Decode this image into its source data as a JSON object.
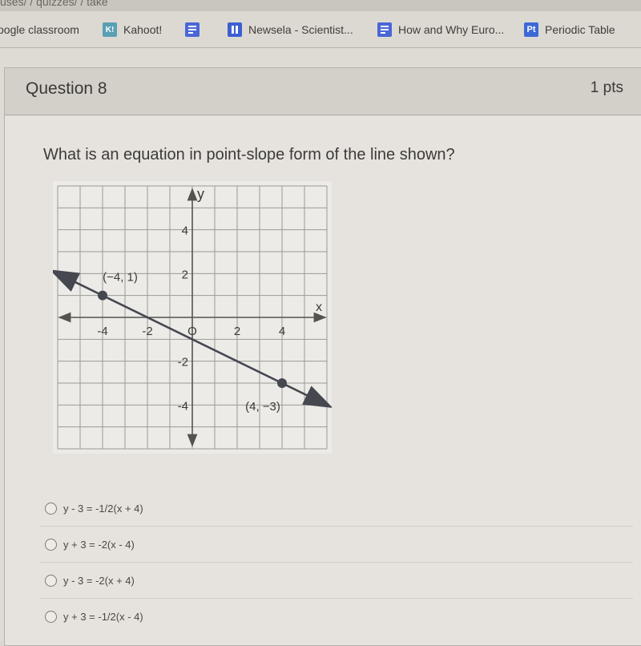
{
  "browser": {
    "url_fragment": "uses/ / quizzes/ / take",
    "bookmarks": [
      {
        "label": "oogle classroom",
        "icon": "none"
      },
      {
        "label": "Kahoot!",
        "icon": "kahoot-icon",
        "glyph": "K!"
      },
      {
        "label": "",
        "icon": "google-doc-icon"
      },
      {
        "label": "Newsela - Scientist...",
        "icon": "newsela-icon"
      },
      {
        "label": "How and Why Euro...",
        "icon": "google-doc-icon"
      },
      {
        "label": "Periodic Table",
        "icon": "periodic-table-icon",
        "glyph": "Pt"
      }
    ]
  },
  "question": {
    "title": "Question 8",
    "points": "1 pts",
    "prompt": "What is an equation in point-slope form of the line shown?"
  },
  "answers": [
    {
      "label": "y - 3 = -1/2(x + 4)",
      "selected": false
    },
    {
      "label": "y + 3 = -2(x - 4)",
      "selected": false
    },
    {
      "label": "y - 3 = -2(x + 4)",
      "selected": false
    },
    {
      "label": "y + 3 = -1/2(x - 4)",
      "selected": false
    }
  ],
  "chart_data": {
    "type": "line",
    "title": "",
    "xlabel": "x",
    "ylabel": "y",
    "xlim": [
      -6,
      6
    ],
    "ylim": [
      -6,
      6
    ],
    "grid": true,
    "x_ticks": [
      -4,
      -2,
      0,
      2,
      4
    ],
    "x_tick_labels": [
      "-4",
      "-2",
      "O",
      "2",
      "4"
    ],
    "y_ticks": [
      4,
      2,
      -2,
      -4
    ],
    "y_tick_labels": [
      "4",
      "2",
      "-2",
      "-4"
    ],
    "points": [
      {
        "x": -4,
        "y": 1,
        "label": "(−4, 1)"
      },
      {
        "x": 4,
        "y": -3,
        "label": "(4, −3)"
      }
    ],
    "line": {
      "slope": -0.5,
      "intercept": -1,
      "arrows": "both"
    },
    "colors": {
      "line": "#45484f",
      "grid": "#9c9a96",
      "axis": "#55534f"
    }
  }
}
